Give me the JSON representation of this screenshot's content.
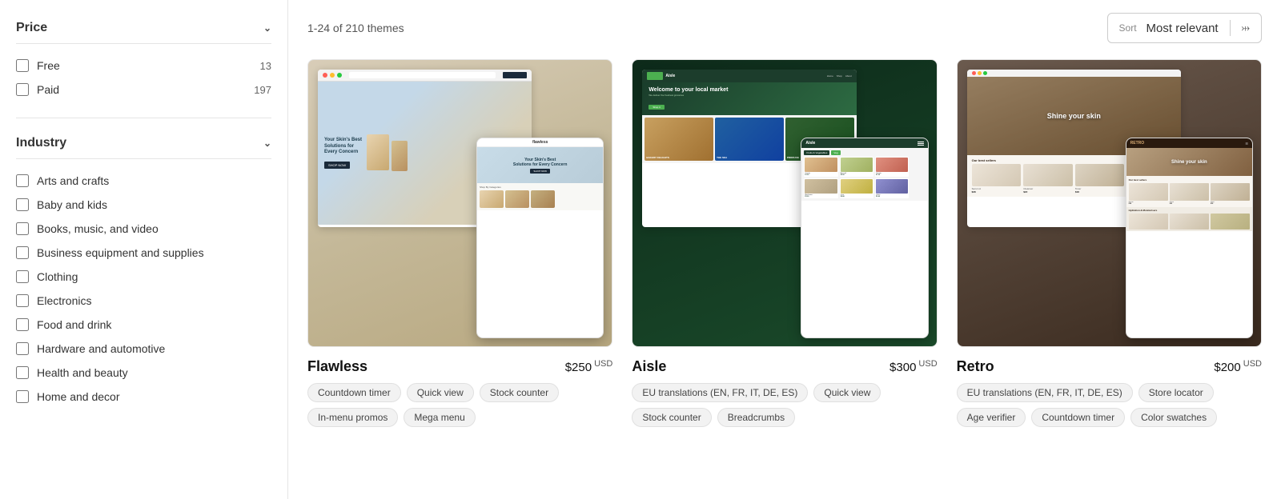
{
  "sidebar": {
    "price_section": {
      "title": "Price",
      "options": [
        {
          "id": "free",
          "label": "Free",
          "count": "13",
          "checked": false
        },
        {
          "id": "paid",
          "label": "Paid",
          "count": "197",
          "checked": false
        }
      ]
    },
    "industry_section": {
      "title": "Industry",
      "items": [
        {
          "id": "arts",
          "label": "Arts and crafts",
          "checked": false
        },
        {
          "id": "baby",
          "label": "Baby and kids",
          "checked": false
        },
        {
          "id": "books",
          "label": "Books, music, and video",
          "checked": false
        },
        {
          "id": "business",
          "label": "Business equipment and supplies",
          "checked": false
        },
        {
          "id": "clothing",
          "label": "Clothing",
          "checked": false
        },
        {
          "id": "electronics",
          "label": "Electronics",
          "checked": false
        },
        {
          "id": "food",
          "label": "Food and drink",
          "checked": false
        },
        {
          "id": "hardware",
          "label": "Hardware and automotive",
          "checked": false
        },
        {
          "id": "health",
          "label": "Health and beauty",
          "checked": false
        },
        {
          "id": "home",
          "label": "Home and decor",
          "checked": false
        }
      ]
    }
  },
  "main": {
    "results_count": "1-24 of 210 themes",
    "sort": {
      "label": "Sort",
      "value": "Most relevant"
    },
    "themes": [
      {
        "id": "flawless",
        "name": "Flawless",
        "price": "$250",
        "currency": "USD",
        "tags": [
          "Countdown timer",
          "Quick view",
          "Stock counter",
          "In-menu promos",
          "Mega menu"
        ]
      },
      {
        "id": "aisle",
        "name": "Aisle",
        "price": "$300",
        "currency": "USD",
        "tags": [
          "EU translations (EN, FR, IT, DE, ES)",
          "Quick view",
          "Stock counter",
          "Breadcrumbs"
        ]
      },
      {
        "id": "retro",
        "name": "Retro",
        "price": "$200",
        "currency": "USD",
        "tags": [
          "EU translations (EN, FR, IT, DE, ES)",
          "Store locator",
          "Age verifier",
          "Countdown timer",
          "Color swatches"
        ]
      }
    ]
  }
}
